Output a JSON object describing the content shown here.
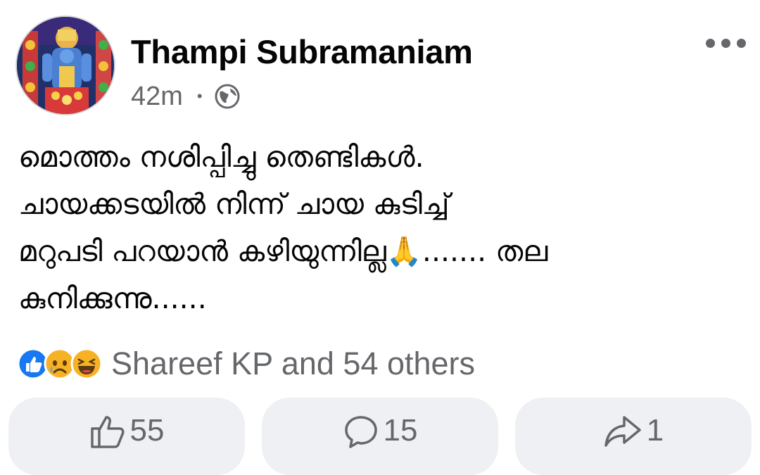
{
  "post": {
    "author": "Thampi Subramaniam",
    "time": "42m",
    "separator": "•",
    "privacy_icon": "globe-icon",
    "more_icon": "more-options-icon",
    "text": "മൊത്തം നശിപ്പിച്ചു തെണ്ടികൾ. ചായക്കടയിൽ നിന്ന് ചായ കുടിച്ച് മറുപടി പറയാൻ കഴിയുന്നില്ല🙏....... തല കുനിക്കുന്നു......",
    "lines": [
      "മൊത്തം നശിപ്പിച്ചു തെണ്ടികൾ.",
      "ചായക്കടയിൽ നിന്ന് ചായ കുടിച്ച്",
      "മറുപടി പറയാൻ കഴിയുന്നില്ല🙏....... തല",
      "കുനിക്കുന്നു......"
    ]
  },
  "reactions": {
    "icons": [
      "like-reaction-icon",
      "sad-reaction-icon",
      "haha-reaction-icon"
    ],
    "summary": "Shareef KP and 54 others"
  },
  "actions": {
    "like_count": "55",
    "comment_count": "15",
    "share_count": "1"
  },
  "colors": {
    "text_primary": "#050505",
    "text_secondary": "#65676b",
    "button_bg": "#eef0f3",
    "like_blue": "#1877f2",
    "emoji_yellow": "#f7b125"
  }
}
